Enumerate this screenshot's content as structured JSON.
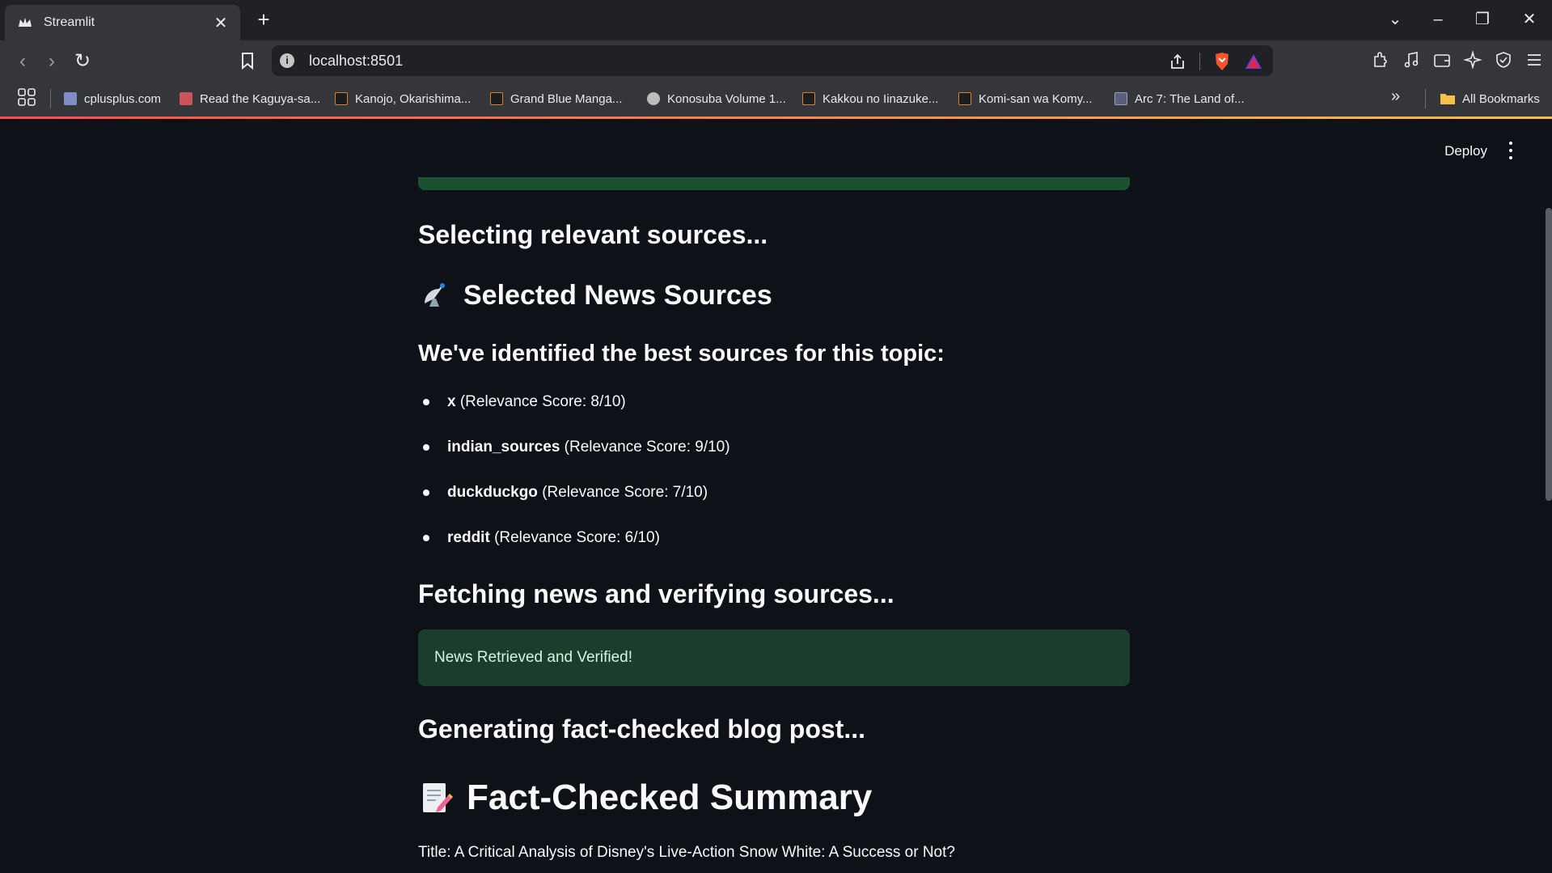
{
  "browser": {
    "tab_title": "Streamlit",
    "url": "localhost:8501",
    "bookmarks": [
      {
        "label": "cplusplus.com",
        "icon": "cplusplus-icon"
      },
      {
        "label": "Read the Kaguya-sa...",
        "icon": "kaguya-icon"
      },
      {
        "label": "Kanojo, Okarishima...",
        "icon": "manga-icon"
      },
      {
        "label": "Grand Blue Manga...",
        "icon": "manga-icon"
      },
      {
        "label": "Konosuba Volume 1...",
        "icon": "globe-icon"
      },
      {
        "label": "Kakkou no Iinazuke...",
        "icon": "manga-icon"
      },
      {
        "label": "Komi-san wa Komy...",
        "icon": "manga-icon"
      },
      {
        "label": "Arc 7: The Land of...",
        "icon": "document-icon"
      }
    ],
    "all_bookmarks_label": "All Bookmarks"
  },
  "header": {
    "deploy_label": "Deploy"
  },
  "content": {
    "selecting_heading": "Selecting relevant sources...",
    "selected_heading": "Selected News Sources",
    "identified_heading": "We've identified the best sources for this topic:",
    "sources": [
      {
        "name": "x",
        "score": "(Relevance Score: 8/10)"
      },
      {
        "name": "indian_sources",
        "score": "(Relevance Score: 9/10)"
      },
      {
        "name": "duckduckgo",
        "score": "(Relevance Score: 7/10)"
      },
      {
        "name": "reddit",
        "score": "(Relevance Score: 6/10)"
      }
    ],
    "fetching_heading": "Fetching news and verifying sources...",
    "success_message": "News Retrieved and Verified!",
    "generating_heading": "Generating fact-checked blog post...",
    "summary_heading": "Fact-Checked Summary",
    "summary_title": "Title: A Critical Analysis of Disney's Live-Action Snow White: A Success or Not?"
  },
  "colors": {
    "background": "#0e1117",
    "success_bg": "#1b3d2b",
    "success_text": "#d7f5e1",
    "accent_strip": "#1b5131"
  }
}
